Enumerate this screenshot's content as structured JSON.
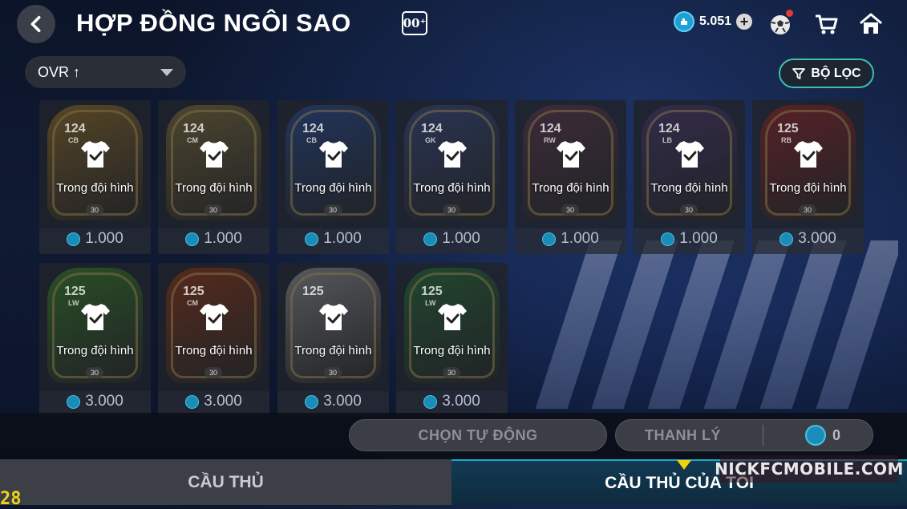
{
  "header": {
    "title": "HỢP ĐỒNG NGÔI SAO",
    "title_badge": "00⁺",
    "back_icon": "chevron-left-icon",
    "currency": {
      "value": "5.051",
      "icon": "coin-icon",
      "plus": "+"
    },
    "icons": [
      "ball-icon",
      "cart-icon",
      "home-icon"
    ]
  },
  "toolbar": {
    "sort_label": "OVR ↑",
    "filter_label": "BỘ LỌC"
  },
  "cards": [
    {
      "ovr": "124",
      "pos": "CB",
      "status": "Trong đội hình",
      "level": "30",
      "price": "1.000",
      "theme": "#8a6a2a"
    },
    {
      "ovr": "124",
      "pos": "CM",
      "status": "Trong đội hình",
      "level": "30",
      "price": "1.000",
      "theme": "#7a6a3a"
    },
    {
      "ovr": "124",
      "pos": "CB",
      "status": "Trong đội hình",
      "level": "30",
      "price": "1.000",
      "theme": "#2a4a8a"
    },
    {
      "ovr": "124",
      "pos": "GK",
      "status": "Trong đội hình",
      "level": "30",
      "price": "1.000",
      "theme": "#3a4a7a"
    },
    {
      "ovr": "124",
      "pos": "RW",
      "status": "Trong đội hình",
      "level": "30",
      "price": "1.000",
      "theme": "#5a3a4a"
    },
    {
      "ovr": "124",
      "pos": "LB",
      "status": "Trong đội hình",
      "level": "30",
      "price": "1.000",
      "theme": "#4a3a6a"
    },
    {
      "ovr": "125",
      "pos": "RB",
      "status": "Trong đội hình",
      "level": "30",
      "price": "3.000",
      "theme": "#8a2a2a"
    },
    {
      "ovr": "125",
      "pos": "LW",
      "status": "Trong đội hình",
      "level": "30",
      "price": "3.000",
      "theme": "#3a7a2a"
    },
    {
      "ovr": "125",
      "pos": "CM",
      "status": "Trong đội hình",
      "level": "30",
      "price": "3.000",
      "theme": "#8a3a1a"
    },
    {
      "ovr": "125",
      "pos": "",
      "status": "Trong đội hình",
      "level": "30",
      "price": "3.000",
      "theme": "#8a8a8a"
    },
    {
      "ovr": "125",
      "pos": "LW",
      "status": "Trong đội hình",
      "level": "30",
      "price": "3.000",
      "theme": "#2a6a3a"
    }
  ],
  "actions": {
    "auto_select": "CHỌN TỰ ĐỘNG",
    "liquidate": "THANH LÝ",
    "liquidate_count": "0"
  },
  "tabs": {
    "players": "CẦU THỦ",
    "my_players": "CẦU THỦ CỦA TÔI"
  },
  "watermark": "NICKFCMOBILE.COM",
  "corner_text": "28"
}
